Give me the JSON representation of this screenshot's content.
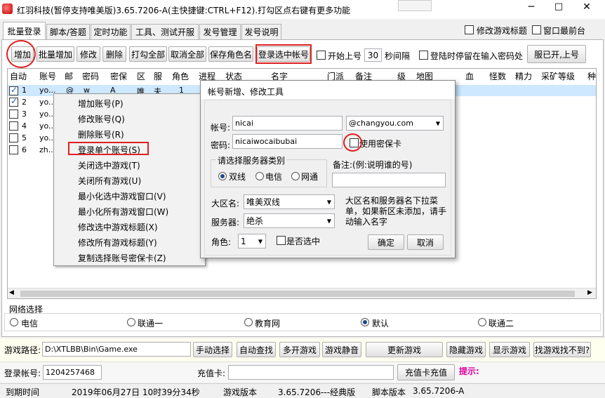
{
  "window": {
    "title": "红羽科技(暂停支持唯美版)3.65.7206-A(主快捷键:CTRL+F12).打勾区点右键有更多功能"
  },
  "tabs": [
    "批量登录",
    "脚本/答题",
    "定时功能",
    "工具、测试开服",
    "发号管理",
    "发号说明"
  ],
  "top_checks": {
    "edit_title": "修改游戏标题",
    "topmost": "窗口最前台"
  },
  "toolbar": {
    "add": "增加",
    "batch_add": "批量增加",
    "edit": "修改",
    "delete": "删除",
    "check_all": "打勾全部",
    "uncheck_all": "取消全部",
    "save_role": "保存角色名",
    "login_selected": "登录选中帐号",
    "start_label": "开始上号",
    "interval_value": "30",
    "interval_unit": "秒间隔",
    "stay_pwd": "登陆时停留在输入密码处",
    "open_btn": "服已开,上号"
  },
  "table": {
    "headers": [
      "自动",
      "账号",
      "邮",
      "密码",
      "密保",
      "区",
      "服",
      "角色",
      "进程",
      "状态",
      "名字",
      "门派",
      "备注",
      "级",
      "地图",
      "血",
      "怪数",
      "精力",
      "采矿等级",
      "种"
    ],
    "rows": [
      {
        "id": "1",
        "acct": "yo...",
        "mail": "@",
        "pwd": "w",
        "mb": "A",
        "zone": "唯",
        "srv": "夫",
        "role": "1",
        "checked": true
      },
      {
        "id": "2",
        "acct": "yo...",
        "checked": true
      },
      {
        "id": "3",
        "acct": "yo...",
        "checked": false
      },
      {
        "id": "4",
        "acct": "yo...",
        "checked": false
      },
      {
        "id": "5",
        "acct": "yo...",
        "checked": false
      },
      {
        "id": "6",
        "acct": "zh...",
        "checked": false
      }
    ]
  },
  "context_menu": {
    "items": [
      "增加账号(P)",
      "修改账号(Q)",
      "删除账号(R)",
      "登录单个账号(S)",
      "关闭选中游戏(T)",
      "关闭所有游戏(U)",
      "最小化选中游戏窗口(V)",
      "最小化所有游戏窗口(W)",
      "修改选中游戏标题(X)",
      "修改所有游戏标题(Y)",
      "复制选择账号密保卡(Z)"
    ]
  },
  "dialog": {
    "title": "帐号新增、修改工具",
    "account_label": "帐号:",
    "account_value": "nicai",
    "domain_value": "@changyou.com",
    "password_label": "密码:",
    "password_value": "nicaiwocaibubai",
    "use_card": "使用密保卡",
    "server_type_label": "请选择服务器类别",
    "server_types": [
      "双线",
      "电信",
      "网通"
    ],
    "note_label": "备注:(例:说明谁的号)",
    "region_label": "大区名:",
    "region_value": "唯美双线",
    "server_label": "服务器:",
    "server_value": "绝杀",
    "hint": "大区名和服务器名下拉菜单，如果新区未添加，请手动输入名字",
    "role_label": "角色:",
    "role_value": "1",
    "is_main": "是否选中",
    "ok": "确定",
    "cancel": "取消"
  },
  "network": {
    "label": "网络选择",
    "options": [
      "电信",
      "联通一",
      "教育网",
      "默认",
      "联通二"
    ],
    "selected": "默认"
  },
  "path_row": {
    "label": "游戏路径:",
    "value": "D:\\XTLBB\\Bin\\Game.exe",
    "buttons": [
      "手动选择",
      "自动查找",
      "多开游戏",
      "游戏静音",
      "更新游戏",
      "隐藏游戏",
      "显示游戏",
      "找游戏找不到?"
    ]
  },
  "login_row": {
    "label": "登录帐号:",
    "value": "1204257468",
    "card_label": "充值卡:",
    "card_button": "充值卡充值",
    "hint": "提示:"
  },
  "status": {
    "expire_label": "到期时间",
    "expire_value": "2019年06月27日 10时39分34秒",
    "game_ver_label": "游戏版本",
    "game_ver_value": "3.65.7206---经典版",
    "script_ver_label": "脚本版本",
    "script_ver_value": "3.65.7206-A"
  },
  "colors": {
    "red_mark": "#e02020",
    "hint_red": "#e000a0",
    "selection": "#cde8ff"
  }
}
